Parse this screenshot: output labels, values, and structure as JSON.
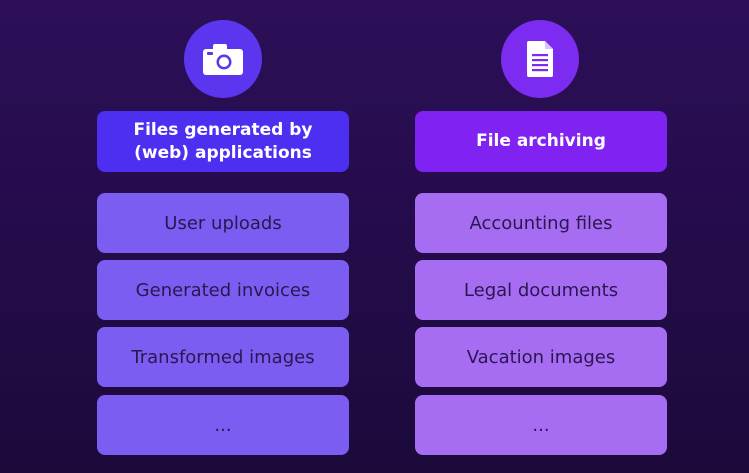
{
  "left_column": {
    "icon": "camera-icon",
    "header": "Files generated by (web) applications",
    "items": [
      "User uploads",
      "Generated invoices",
      "Transformed images",
      "..."
    ]
  },
  "right_column": {
    "icon": "document-icon",
    "header": "File archiving",
    "items": [
      "Accounting files",
      "Legal documents",
      "Vacation images",
      "..."
    ]
  },
  "colors": {
    "background": "#250c4c",
    "left_accent": "#4c2ff0",
    "left_items": "#7b5ef1",
    "right_accent": "#7f22f2",
    "right_items": "#a66df3"
  }
}
